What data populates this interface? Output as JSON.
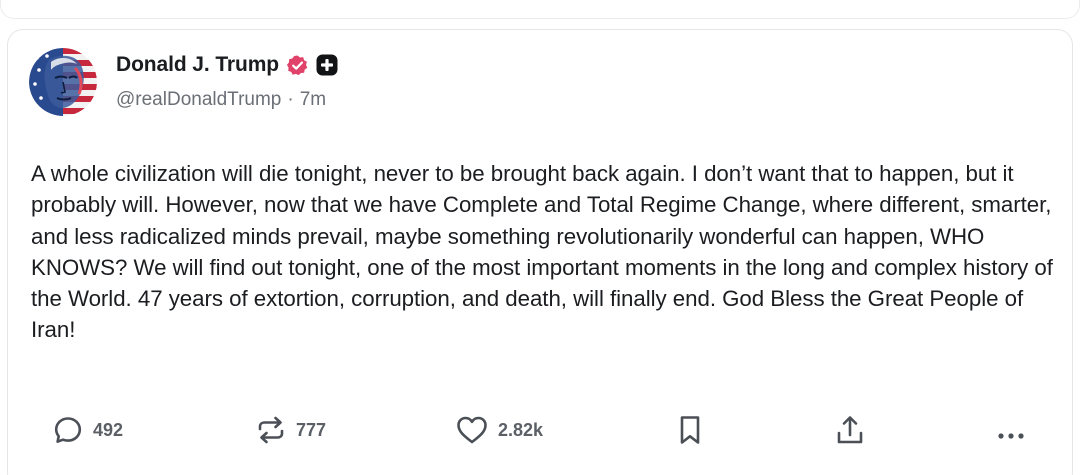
{
  "post": {
    "author": {
      "display_name": "Donald J. Trump",
      "handle": "@realDonaldTrump",
      "separator": "·",
      "time": "7m",
      "verified_color": "#e0426a"
    },
    "text": "A whole civilization will die tonight, never to be brought back again. I don’t want that to happen, but it probably will. However, now that we have Complete and Total Regime Change, where different, smarter, and less radicalized minds prevail, maybe something revolutionarily wonderful can happen, WHO KNOWS? We will find out tonight, one of the most important moments in the long and complex history of the World. 47 years of extortion, corruption, and death, will finally end. God Bless the Great People of Iran!",
    "actions": {
      "replies": {
        "icon": "reply-icon",
        "count": "492"
      },
      "reposts": {
        "icon": "repost-icon",
        "count": "777"
      },
      "likes": {
        "icon": "heart-icon",
        "count": "2.82k"
      },
      "bookmark": {
        "icon": "bookmark-icon"
      },
      "share": {
        "icon": "share-icon"
      },
      "more": {
        "icon": "more-icon"
      }
    }
  }
}
